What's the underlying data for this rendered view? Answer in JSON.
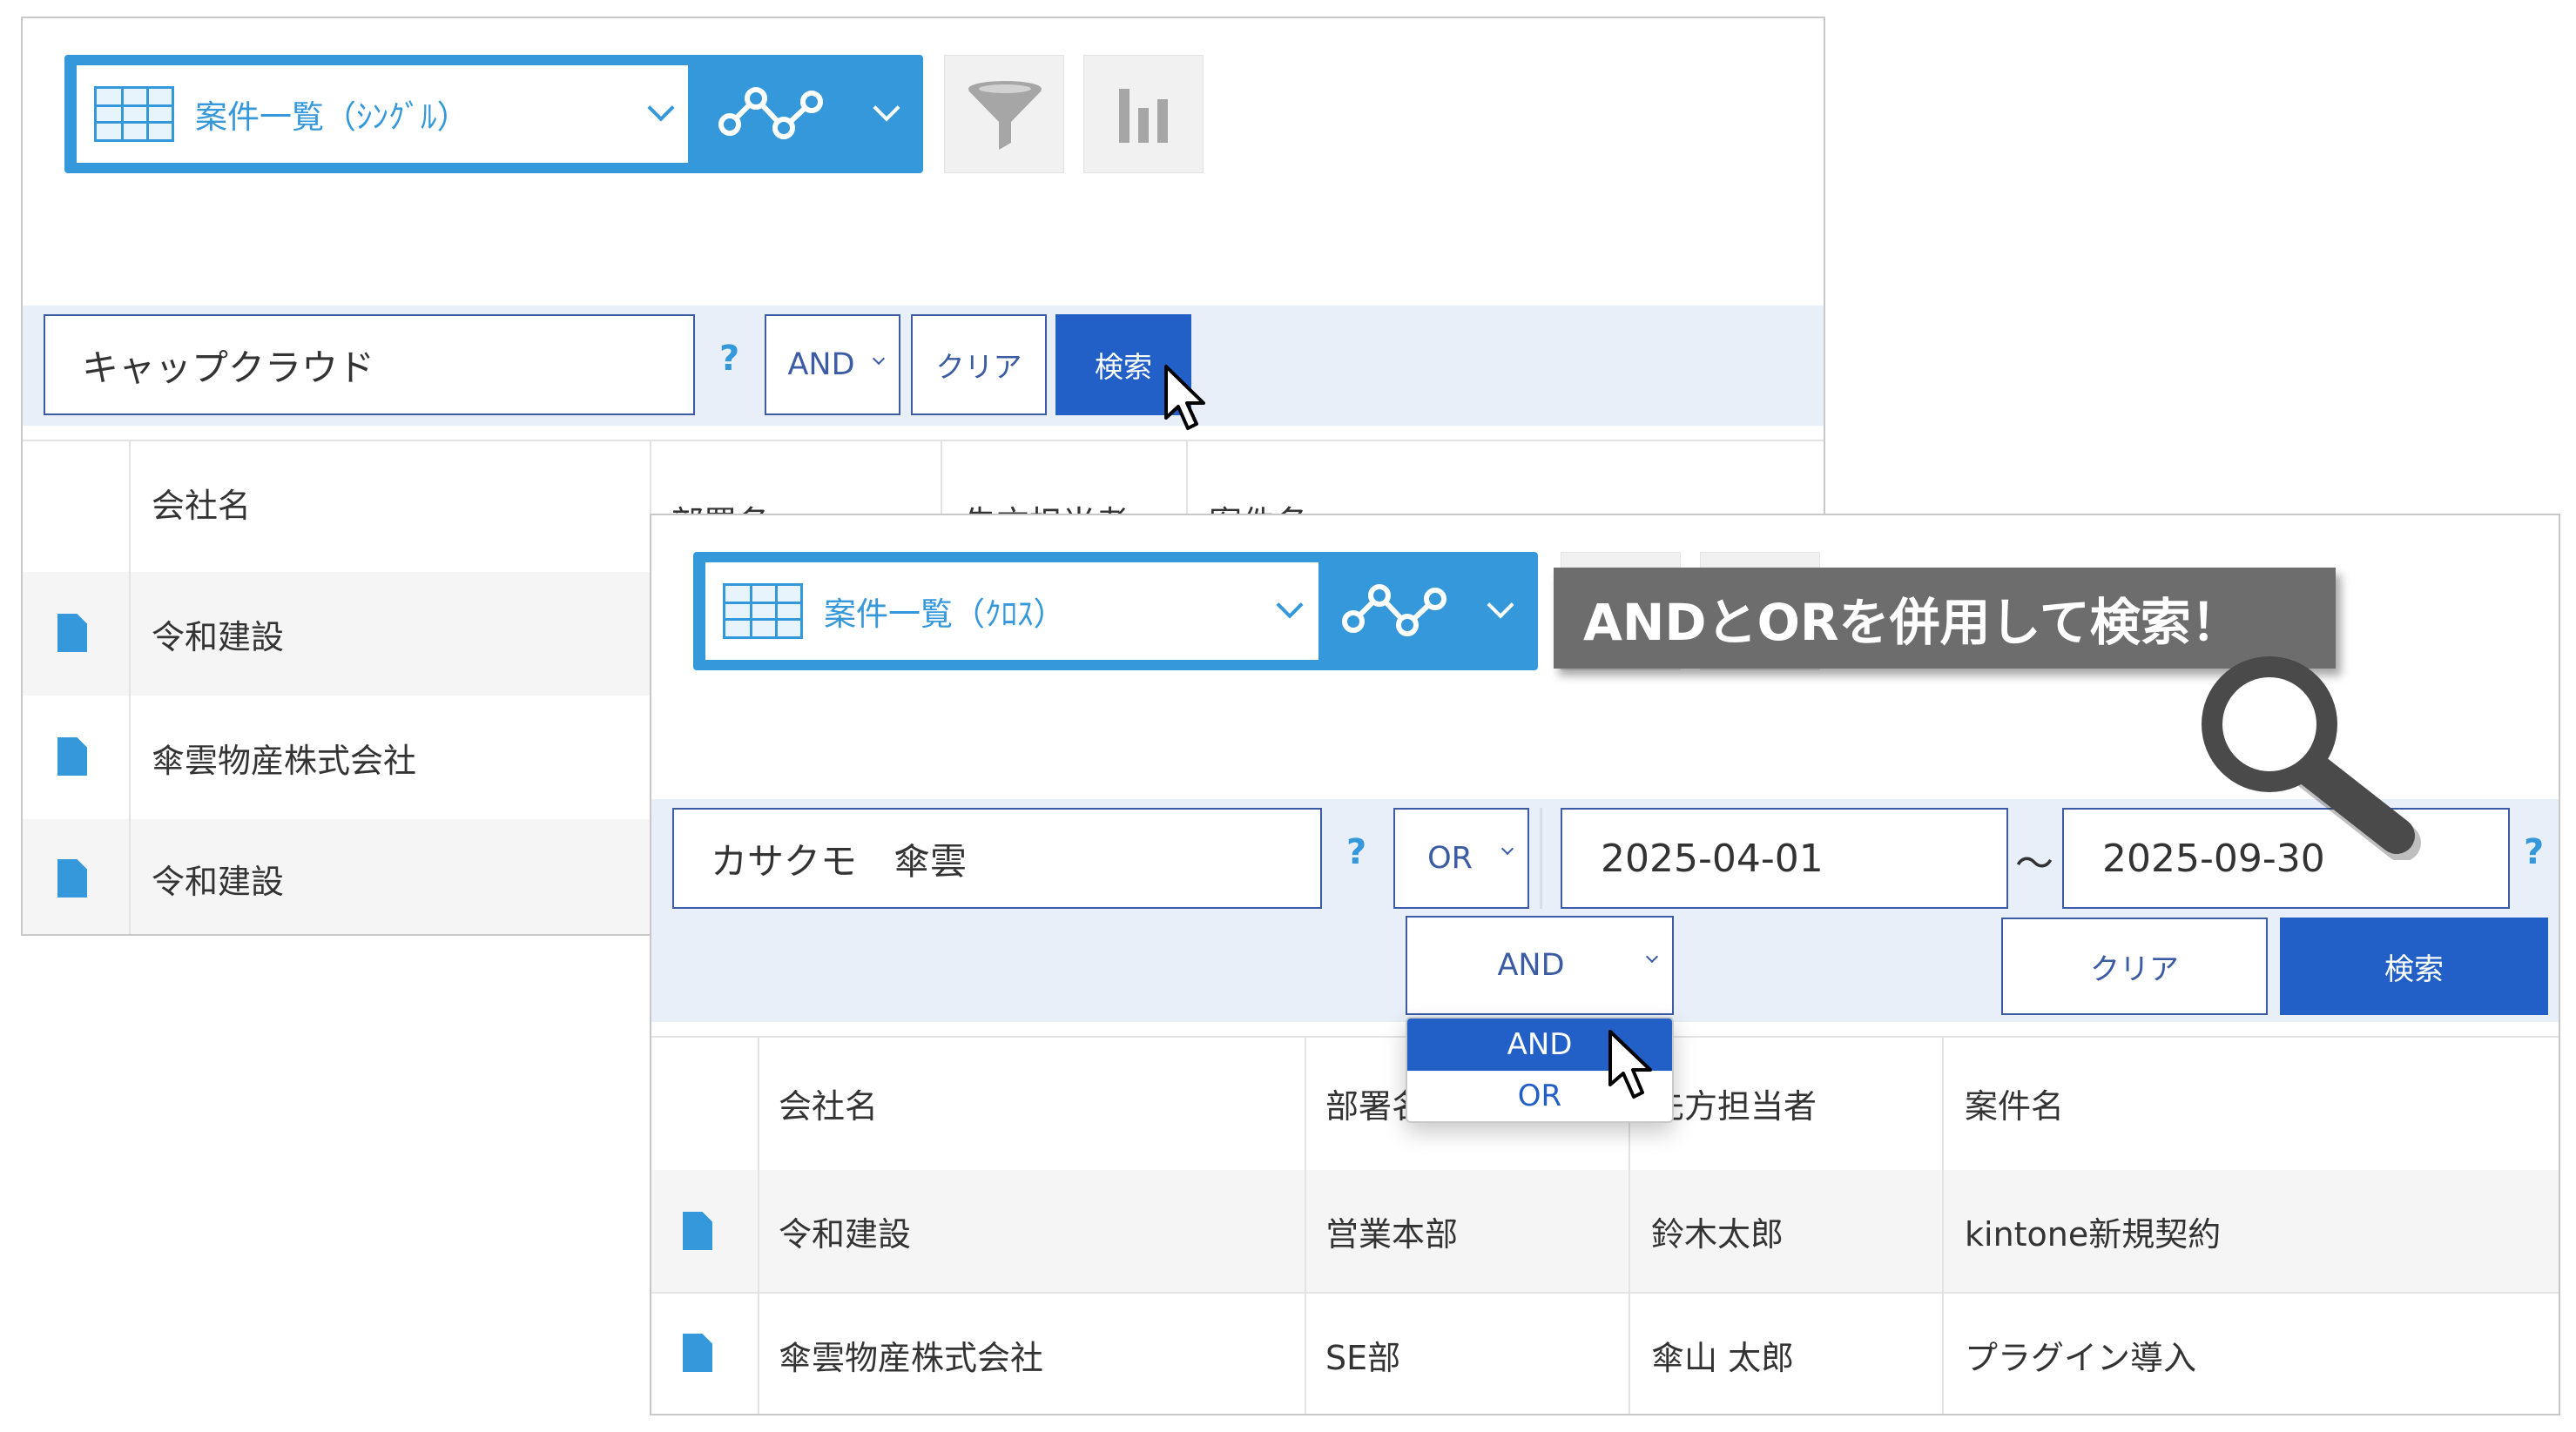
{
  "back": {
    "view_selector": {
      "label": "案件一覧（ｼﾝｸﾞﾙ）"
    },
    "search": {
      "keyword": "キャップクラウド",
      "help": "?",
      "operator": "AND",
      "clear_label": "クリア",
      "search_label": "検索"
    },
    "table": {
      "headers": [
        "会社名",
        "部署名",
        "先方担当者",
        "案件名"
      ],
      "rows": [
        [
          "令和建設"
        ],
        [
          "傘雲物産株式会社"
        ],
        [
          "令和建設"
        ]
      ]
    }
  },
  "front": {
    "view_selector": {
      "label": "案件一覧（ｸﾛｽ）"
    },
    "callout": "ANDとORを併用して検索！",
    "search": {
      "keyword": "カサクモ　傘雲",
      "help": "?",
      "operator": "OR",
      "date_from": "2025-04-01",
      "date_sep": "～",
      "date_to": "2025-09-30",
      "date_help": "?",
      "combine_operator": "AND",
      "dropdown_options": [
        "AND",
        "OR"
      ],
      "clear_label": "クリア",
      "search_label": "検索"
    },
    "table": {
      "headers": [
        "会社名",
        "部署名",
        "先方担当者",
        "案件名"
      ],
      "rows": [
        [
          "令和建設",
          "営業本部",
          "鈴木太郎",
          "kintone新規契約"
        ],
        [
          "傘雲物産株式会社",
          "SE部",
          "傘山 太郎",
          "プラグイン導入"
        ]
      ]
    }
  },
  "colors": {
    "accent": "#3498db",
    "primary_button": "#2260c7",
    "search_bar": "#e9eff9",
    "callout_bg": "#6d6d6d"
  }
}
